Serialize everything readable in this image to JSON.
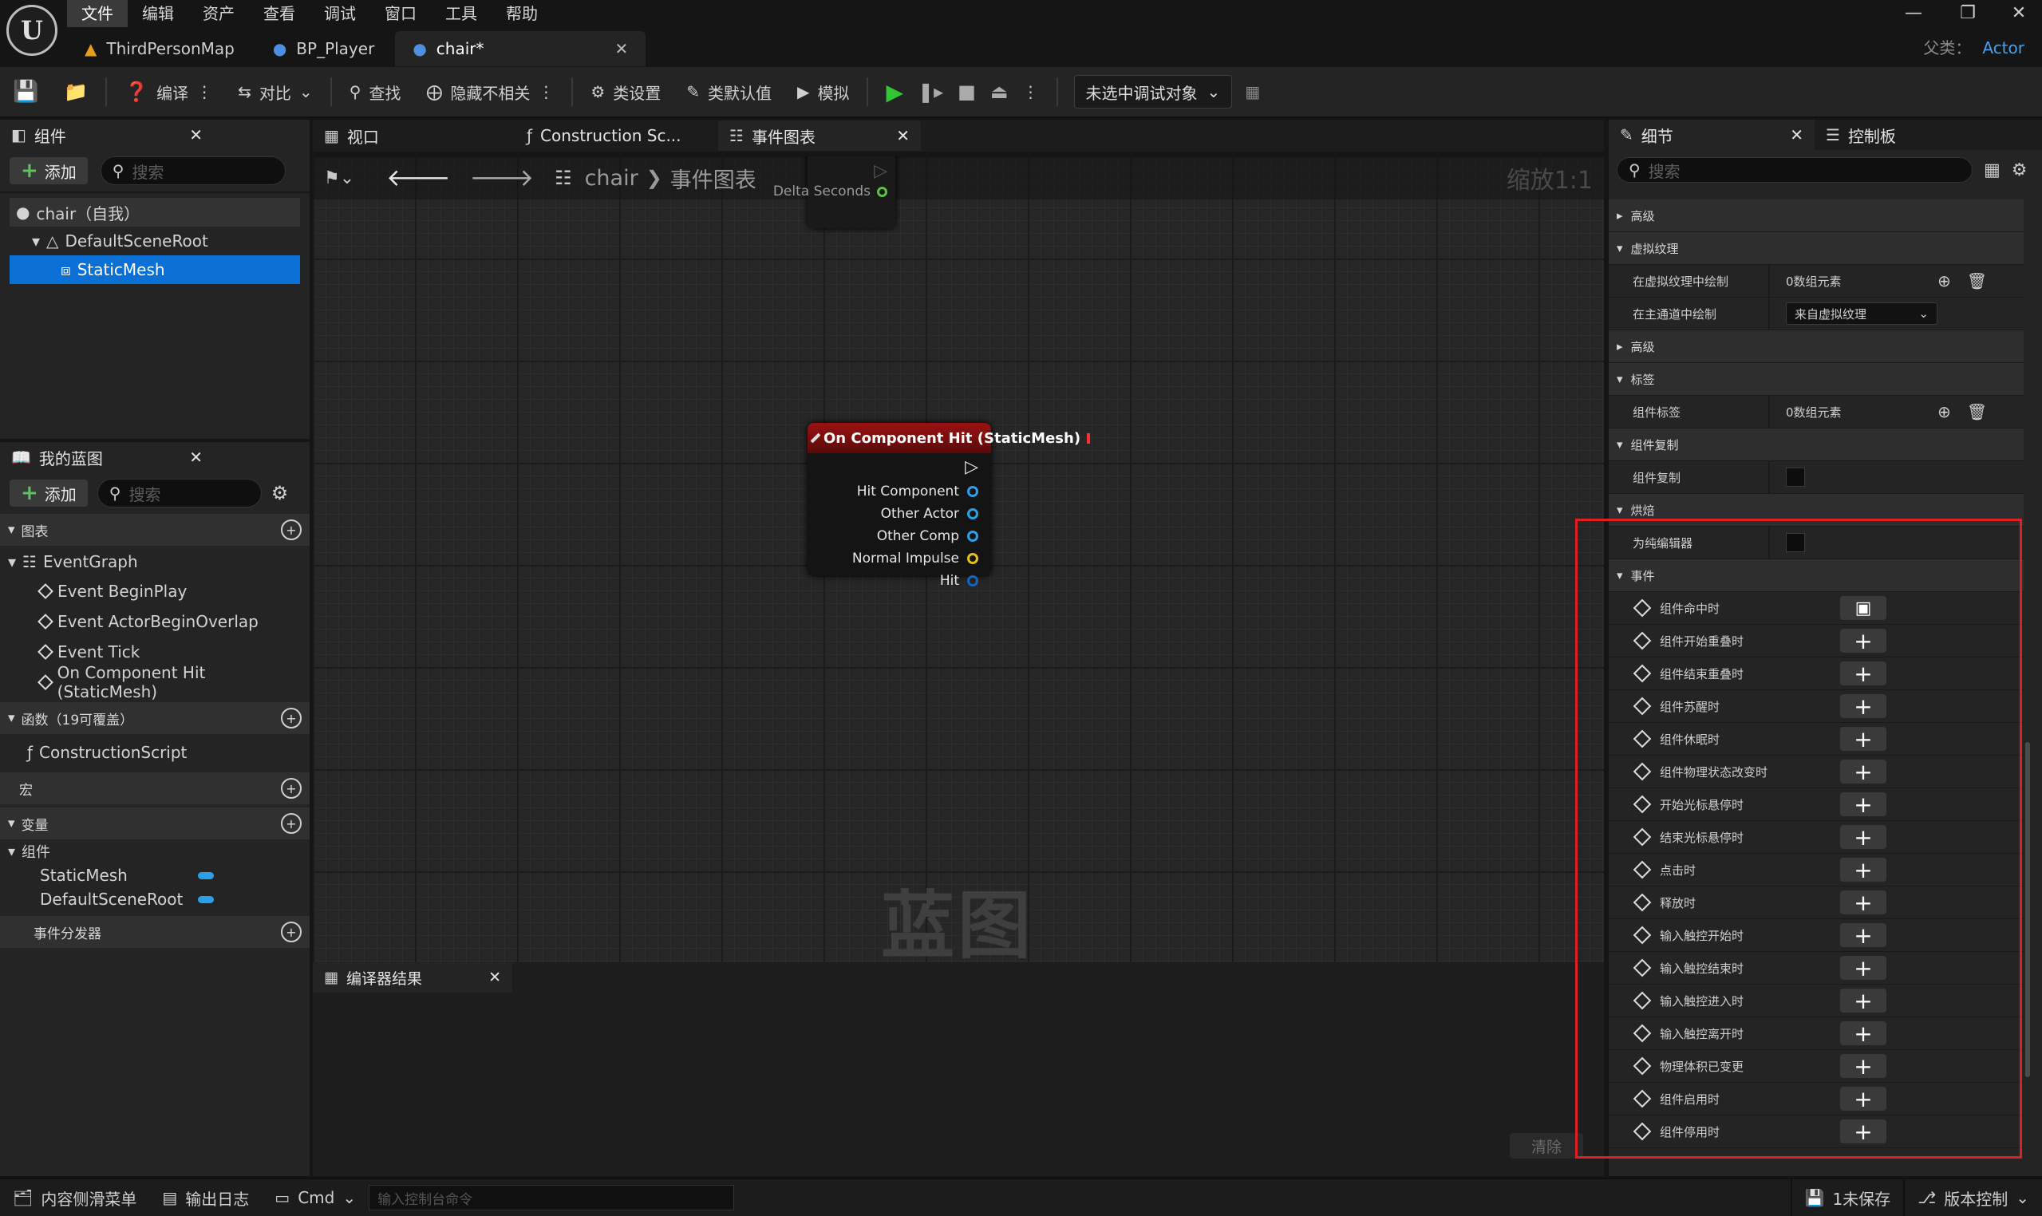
{
  "menu": [
    "文件",
    "编辑",
    "资产",
    "查看",
    "调试",
    "窗口",
    "工具",
    "帮助"
  ],
  "tabs": [
    {
      "label": "ThirdPersonMap"
    },
    {
      "label": "BP_Player"
    },
    {
      "label": "chair*"
    }
  ],
  "parent_class": {
    "label": "父类：",
    "value": "Actor"
  },
  "toolbar": {
    "compile": "编译",
    "diff": "对比",
    "find": "查找",
    "hide_unrelated": "隐藏不相关",
    "class_settings": "类设置",
    "class_defaults": "类默认值",
    "simulate": "模拟",
    "debug_object": "未选中调试对象"
  },
  "components_panel": {
    "tab": "组件",
    "add": "添加",
    "search_placeholder": "搜索",
    "tree": [
      {
        "label": "chair（自我）"
      },
      {
        "label": "DefaultSceneRoot"
      },
      {
        "label": "StaticMesh"
      }
    ]
  },
  "my_blueprint": {
    "tab": "我的蓝图",
    "add": "添加",
    "search_placeholder": "搜索",
    "graphs_header": "图表",
    "event_graph": "EventGraph",
    "events": [
      "Event BeginPlay",
      "Event ActorBeginOverlap",
      "Event Tick",
      "On Component Hit (StaticMesh)"
    ],
    "functions_header": "函数（19可覆盖）",
    "construction_script": "ConstructionScript",
    "macros_header": "宏",
    "variables_header": "变量",
    "components_group": "组件",
    "variables": [
      "StaticMesh",
      "DefaultSceneRoot"
    ],
    "dispatchers_header": "事件分发器"
  },
  "center_tabs": {
    "viewport": "视口",
    "construction": "Construction Sc...",
    "event_graph": "事件图表"
  },
  "breadcrumb": {
    "root": "chair",
    "current": "事件图表",
    "zoom": "缩放1:1"
  },
  "graph": {
    "tick_output": "Delta Seconds",
    "node_title": "On Component Hit (StaticMesh)",
    "pins": [
      "Hit Component",
      "Other Actor",
      "Other Comp",
      "Normal Impulse",
      "Hit"
    ],
    "watermark": "蓝图"
  },
  "compiler": {
    "tab": "编译器结果",
    "clear": "清除"
  },
  "details": {
    "tab": "细节",
    "tab2": "控制板",
    "search_placeholder": "搜索",
    "rows": [
      {
        "type": "cat",
        "label": "高级",
        "expanded": false
      },
      {
        "type": "cat",
        "label": "虚拟纹理",
        "expanded": true
      },
      {
        "type": "prop",
        "label": "在虚拟纹理中绘制",
        "value": "0数组元素",
        "kind": "array"
      },
      {
        "type": "prop",
        "label": "在主通道中绘制",
        "value": "来自虚拟纹理",
        "kind": "dropdown"
      },
      {
        "type": "cat",
        "label": "高级",
        "expanded": false
      },
      {
        "type": "cat",
        "label": "标签",
        "expanded": true
      },
      {
        "type": "prop",
        "label": "组件标签",
        "value": "0数组元素",
        "kind": "array"
      },
      {
        "type": "cat",
        "label": "组件复制",
        "expanded": true
      },
      {
        "type": "prop",
        "label": "组件复制",
        "value": "",
        "kind": "checkbox"
      },
      {
        "type": "cat",
        "label": "烘焙",
        "expanded": true
      },
      {
        "type": "prop",
        "label": "为纯编辑器",
        "value": "",
        "kind": "checkbox"
      },
      {
        "type": "cat",
        "label": "事件",
        "expanded": true
      }
    ],
    "events": [
      "组件命中时",
      "组件开始重叠时",
      "组件结束重叠时",
      "组件苏醒时",
      "组件休眠时",
      "组件物理状态改变时",
      "开始光标悬停时",
      "结束光标悬停时",
      "点击时",
      "释放时",
      "输入触控开始时",
      "输入触控结束时",
      "输入触控进入时",
      "输入触控离开时",
      "物理体积已变更",
      "组件启用时",
      "组件停用时"
    ]
  },
  "statusbar": {
    "content_drawer": "内容侧滑菜单",
    "output_log": "输出日志",
    "cmd": "Cmd",
    "console_placeholder": "输入控制台命令",
    "unsaved": "1未保存",
    "source_control": "版本控制"
  },
  "colors": {
    "accent": "#0a70d6",
    "highlight": "#e02020",
    "node_header": "#9b1111",
    "play": "#33c633"
  }
}
